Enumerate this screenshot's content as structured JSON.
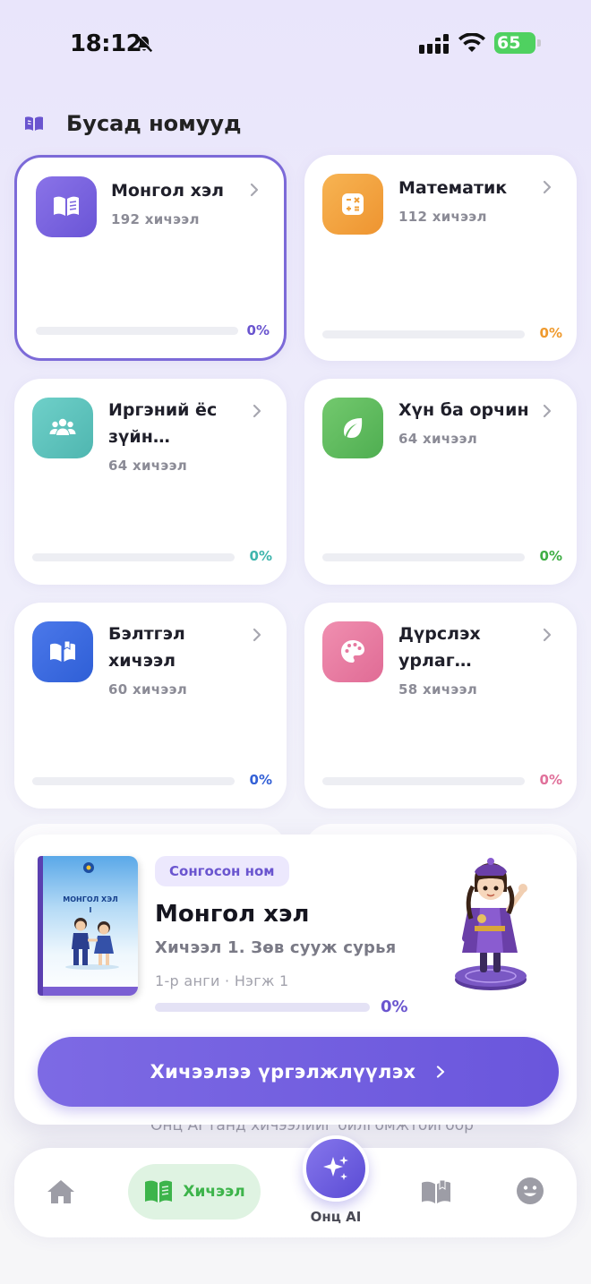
{
  "status_bar": {
    "time": "18:12",
    "battery": "65"
  },
  "section": {
    "title": "Бусад номууд"
  },
  "subjects": [
    {
      "name": "Монгол хэл",
      "count": "192 хичээл",
      "progress": "0%",
      "progress_value": 0,
      "color": "#7b64df",
      "text_color": "#6a55cf",
      "icon": "book-icon"
    },
    {
      "name": "Математик",
      "count": "112 хичээл",
      "progress": "0%",
      "progress_value": 0,
      "color": "#f3a443",
      "text_color": "#ef9a2e",
      "icon": "calculator-icon"
    },
    {
      "name": "Иргэний ёс зүйн боловсрол",
      "count": "64 хичээл",
      "progress": "0%",
      "progress_value": 0,
      "color": "#5cc3bd",
      "text_color": "#3fb5ad",
      "icon": "people-icon"
    },
    {
      "name": "Хүн ба орчин",
      "count": "64 хичээл",
      "progress": "0%",
      "progress_value": 0,
      "color": "#5fbe5f",
      "text_color": "#3fae45",
      "icon": "leaf-icon"
    },
    {
      "name": "Бэлтгэл хичээл",
      "count": "60 хичээл",
      "progress": "0%",
      "progress_value": 0,
      "color": "#3f6be0",
      "text_color": "#3360d6",
      "icon": "open-book-icon"
    },
    {
      "name": "Дүрслэх урлаг Технологи",
      "count": "58 хичээл",
      "progress": "0%",
      "progress_value": 0,
      "color": "#ea7ea2",
      "text_color": "#e0709a",
      "icon": "palette-icon"
    }
  ],
  "selected_book": {
    "badge": "Сонгосон ном",
    "title": "Монгол хэл",
    "lesson": "Хичээл 1. Зөв сууж сурья",
    "meta": "1-р анги · Нэгж 1",
    "progress": "0%",
    "progress_value": 0,
    "cover_title": "МОНГОЛ ХЭЛ",
    "cover_number": "I",
    "continue_label": "Хичээлээ үргэлжлүүлэх"
  },
  "hint": "Онц AI танд хичээлийг ойлгомжтойгоор",
  "nav": {
    "lesson_label": "Хичээл",
    "ai_label": "Онц AI"
  }
}
